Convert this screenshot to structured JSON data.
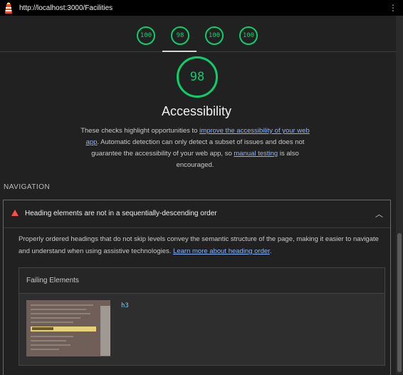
{
  "titlebar": {
    "url": "http://localhost:3000/Facilities",
    "menu_icon": "kebab-menu-icon",
    "logo_icon": "lighthouse-icon"
  },
  "gauges": [
    {
      "score": "100"
    },
    {
      "score": "98"
    },
    {
      "score": "100"
    },
    {
      "score": "100"
    }
  ],
  "colors": {
    "pass": "#0cce6b",
    "fail": "#ff4e42",
    "link": "#8ab4f8"
  },
  "category": {
    "score": "98",
    "title": "Accessibility",
    "desc_1": "These checks highlight opportunities to ",
    "desc_link_1": "improve the accessibility of your web app",
    "desc_2": ". Automatic detection can only detect a subset of issues and does not guarantee the accessibility of your web app, so ",
    "desc_link_2": "manual testing",
    "desc_3": " is also encouraged."
  },
  "section": {
    "label": "NAVIGATION"
  },
  "audit": {
    "title": "Heading elements are not in a sequentially-descending order",
    "desc": "Properly ordered headings that do not skip levels convey the semantic structure of the page, making it easier to navigate and understand when using assistive technologies. ",
    "desc_link": "Learn more about heading order",
    "desc_end": ".",
    "failing_header": "Failing Elements",
    "node": "h3"
  }
}
